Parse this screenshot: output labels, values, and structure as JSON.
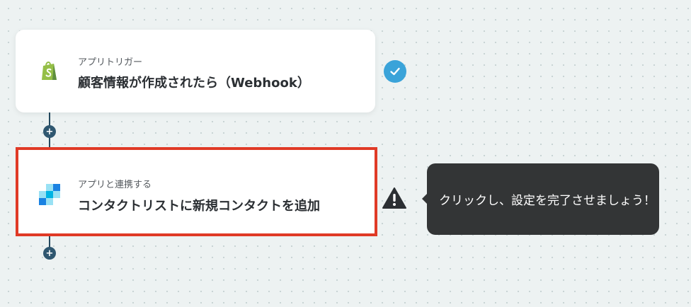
{
  "flow": {
    "steps": [
      {
        "subtitle": "アプリトリガー",
        "title": "顧客情報が作成されたら（Webhook）",
        "app_icon": "shopify-icon",
        "status": "completed",
        "status_icon": "check-icon"
      },
      {
        "subtitle": "アプリと連携する",
        "title": "コンタクトリストに新規コンタクトを追加",
        "app_icon": "sendgrid-icon",
        "status": "warning",
        "status_icon": "warning-icon"
      }
    ],
    "add_step_symbol": "+"
  },
  "tooltip": {
    "text": "クリックし、設定を完了させましょう！"
  },
  "colors": {
    "highlight_border": "#e03a26",
    "check_badge": "#3aa3d9",
    "connector": "#254a5f",
    "tooltip_bg": "#333536"
  }
}
